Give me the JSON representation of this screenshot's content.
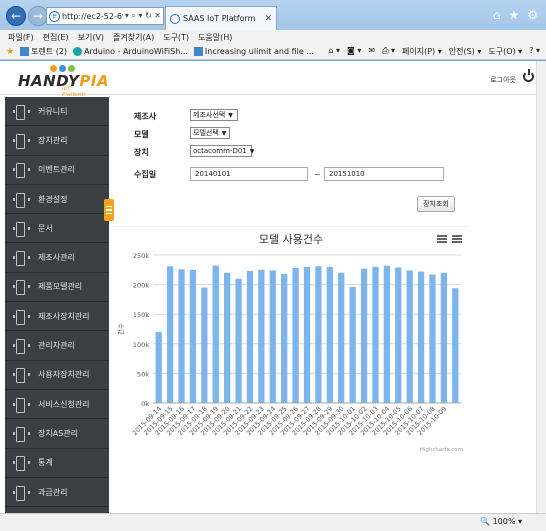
{
  "browser": {
    "url": "http://ec2-52-69-161...",
    "tab_title": "SAAS IoT Platform",
    "menus": [
      "파일(F)",
      "편집(E)",
      "보기(V)",
      "즐겨찾기(A)",
      "도구(T)",
      "도움말(H)"
    ],
    "favorites": [
      "토렌트 (2)",
      "Arduino - ArduinoWiFiSh...",
      "Increasing ulimit and file ..."
    ],
    "toolbar_right": [
      "페이지(P) ▾",
      "안전(S) ▾",
      "도구(O) ▾"
    ],
    "zoom": "100%"
  },
  "header": {
    "logo_main": "HANDY",
    "logo_accent": "PIA",
    "logo_sub": "IoT Platform",
    "logout": "로그아웃"
  },
  "sidebar": {
    "items": [
      "커뮤니티",
      "장치관리",
      "이벤트관리",
      "환경설정",
      "문서",
      "제조사관리",
      "제품모델관리",
      "제조사장치관리",
      "관리자관리",
      "사용자장치관리",
      "서비스신청관리",
      "장치AS관리",
      "통계",
      "과금관리"
    ]
  },
  "filters": {
    "maker_label": "제조사",
    "maker_value": "제조사선택",
    "model_label": "모델",
    "model_value": "모델선택",
    "device_label": "장치",
    "device_value": "octacomm-D01",
    "period_label": "수집일",
    "date_from": "20140101",
    "tilde": "~",
    "date_to": "20151010",
    "search_button": "장치조회"
  },
  "chart_data": {
    "type": "bar",
    "title": "모델 사용건수",
    "ylabel": "건수",
    "ylim": [
      0,
      250000
    ],
    "ytick_labels": [
      "0k",
      "50k",
      "100k",
      "150k",
      "200k",
      "250k"
    ],
    "credit": "Highcharts.com",
    "color": "#7cb5ec",
    "categories": [
      "2015-09-14",
      "2015-09-15",
      "2015-09-16",
      "2015-09-17",
      "2015-09-18",
      "2015-09-19",
      "2015-09-20",
      "2015-09-21",
      "2015-09-22",
      "2015-09-23",
      "2015-09-24",
      "2015-09-25",
      "2015-09-26",
      "2015-09-27",
      "2015-09-28",
      "2015-09-29",
      "2015-09-30",
      "2015-10-01",
      "2015-10-02",
      "2015-10-03",
      "2015-10-04",
      "2015-10-05",
      "2015-10-06",
      "2015-10-07",
      "2015-10-08",
      "2015-10-09"
    ],
    "values": [
      120000,
      231000,
      226000,
      225000,
      195000,
      232000,
      220000,
      210000,
      223000,
      225000,
      224000,
      218000,
      228000,
      230000,
      231000,
      230000,
      220000,
      196000,
      227000,
      230000,
      232000,
      229000,
      224000,
      222000,
      217000,
      220000,
      194000
    ]
  }
}
